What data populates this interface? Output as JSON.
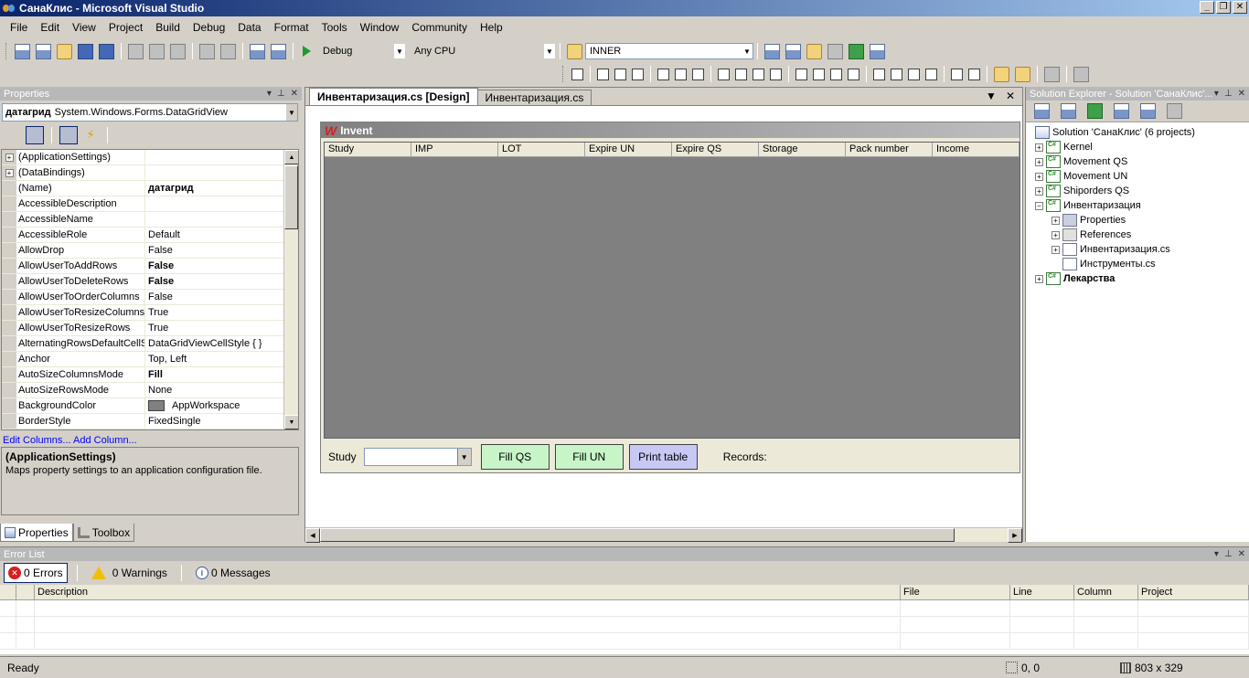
{
  "window": {
    "title": "СанаКлис - Microsoft Visual Studio"
  },
  "menu": [
    "File",
    "Edit",
    "View",
    "Project",
    "Build",
    "Debug",
    "Data",
    "Format",
    "Tools",
    "Window",
    "Community",
    "Help"
  ],
  "toolbar": {
    "config": "Debug",
    "platform": "Any CPU",
    "find": "INNER"
  },
  "properties": {
    "title": "Properties",
    "object_name": "датагрид",
    "object_type": "System.Windows.Forms.DataGridView",
    "rows": [
      {
        "name": "(ApplicationSettings)",
        "value": "",
        "expand": true
      },
      {
        "name": "(DataBindings)",
        "value": "",
        "expand": true
      },
      {
        "name": "(Name)",
        "value": "датагрид",
        "bold": true
      },
      {
        "name": "AccessibleDescription",
        "value": ""
      },
      {
        "name": "AccessibleName",
        "value": ""
      },
      {
        "name": "AccessibleRole",
        "value": "Default"
      },
      {
        "name": "AllowDrop",
        "value": "False"
      },
      {
        "name": "AllowUserToAddRows",
        "value": "False",
        "bold": true
      },
      {
        "name": "AllowUserToDeleteRows",
        "value": "False",
        "bold": true
      },
      {
        "name": "AllowUserToOrderColumns",
        "value": "False"
      },
      {
        "name": "AllowUserToResizeColumns",
        "value": "True"
      },
      {
        "name": "AllowUserToResizeRows",
        "value": "True"
      },
      {
        "name": "AlternatingRowsDefaultCellS",
        "value": "DataGridViewCellStyle { }"
      },
      {
        "name": "Anchor",
        "value": "Top, Left"
      },
      {
        "name": "AutoSizeColumnsMode",
        "value": "Fill",
        "bold": true
      },
      {
        "name": "AutoSizeRowsMode",
        "value": "None"
      },
      {
        "name": "BackgroundColor",
        "value": "AppWorkspace",
        "swatch": "#808080"
      },
      {
        "name": "BorderStyle",
        "value": "FixedSingle"
      }
    ],
    "commands": "Edit Columns... Add Column...",
    "desc_title": "(ApplicationSettings)",
    "desc_text": "Maps property settings to an application configuration file.",
    "tabs": [
      "Properties",
      "Toolbox"
    ]
  },
  "designer": {
    "tabs": [
      "Инвентаризация.cs [Design]",
      "Инвентаризация.cs"
    ],
    "form_title": "Invent",
    "columns": [
      "Study",
      "IMP",
      "LOT",
      "Expire UN",
      "Expire QS",
      "Storage",
      "Pack number",
      "Income"
    ],
    "study_label": "Study",
    "buttons": {
      "fill_qs": "Fill QS",
      "fill_un": "Fill UN",
      "print": "Print table"
    },
    "records_label": "Records:"
  },
  "solution": {
    "title": "Solution Explorer - Solution 'СанаКлис'...",
    "root": "Solution 'СанаКлис' (6 projects)",
    "nodes": [
      {
        "label": "Kernel",
        "type": "proj",
        "level": 1,
        "expand": "+"
      },
      {
        "label": "Movement QS",
        "type": "proj",
        "level": 1,
        "expand": "+"
      },
      {
        "label": "Movement UN",
        "type": "proj",
        "level": 1,
        "expand": "+"
      },
      {
        "label": "Shiporders QS",
        "type": "proj",
        "level": 1,
        "expand": "+"
      },
      {
        "label": "Инвентаризация",
        "type": "proj",
        "level": 1,
        "expand": "-"
      },
      {
        "label": "Properties",
        "type": "fold",
        "level": 2,
        "expand": "+"
      },
      {
        "label": "References",
        "type": "refs",
        "level": 2,
        "expand": "+"
      },
      {
        "label": "Инвентаризация.cs",
        "type": "file",
        "level": 2,
        "expand": "+"
      },
      {
        "label": "Инструменты.cs",
        "type": "file",
        "level": 2,
        "expand": ""
      },
      {
        "label": "Лекарства",
        "type": "proj",
        "level": 1,
        "expand": "+",
        "bold": true
      }
    ]
  },
  "errors": {
    "title": "Error List",
    "errors": "0 Errors",
    "warnings": "0 Warnings",
    "messages": "0 Messages",
    "columns": [
      "Description",
      "File",
      "Line",
      "Column",
      "Project"
    ]
  },
  "status": {
    "text": "Ready",
    "position": "0, 0",
    "size": "803 x 329"
  }
}
